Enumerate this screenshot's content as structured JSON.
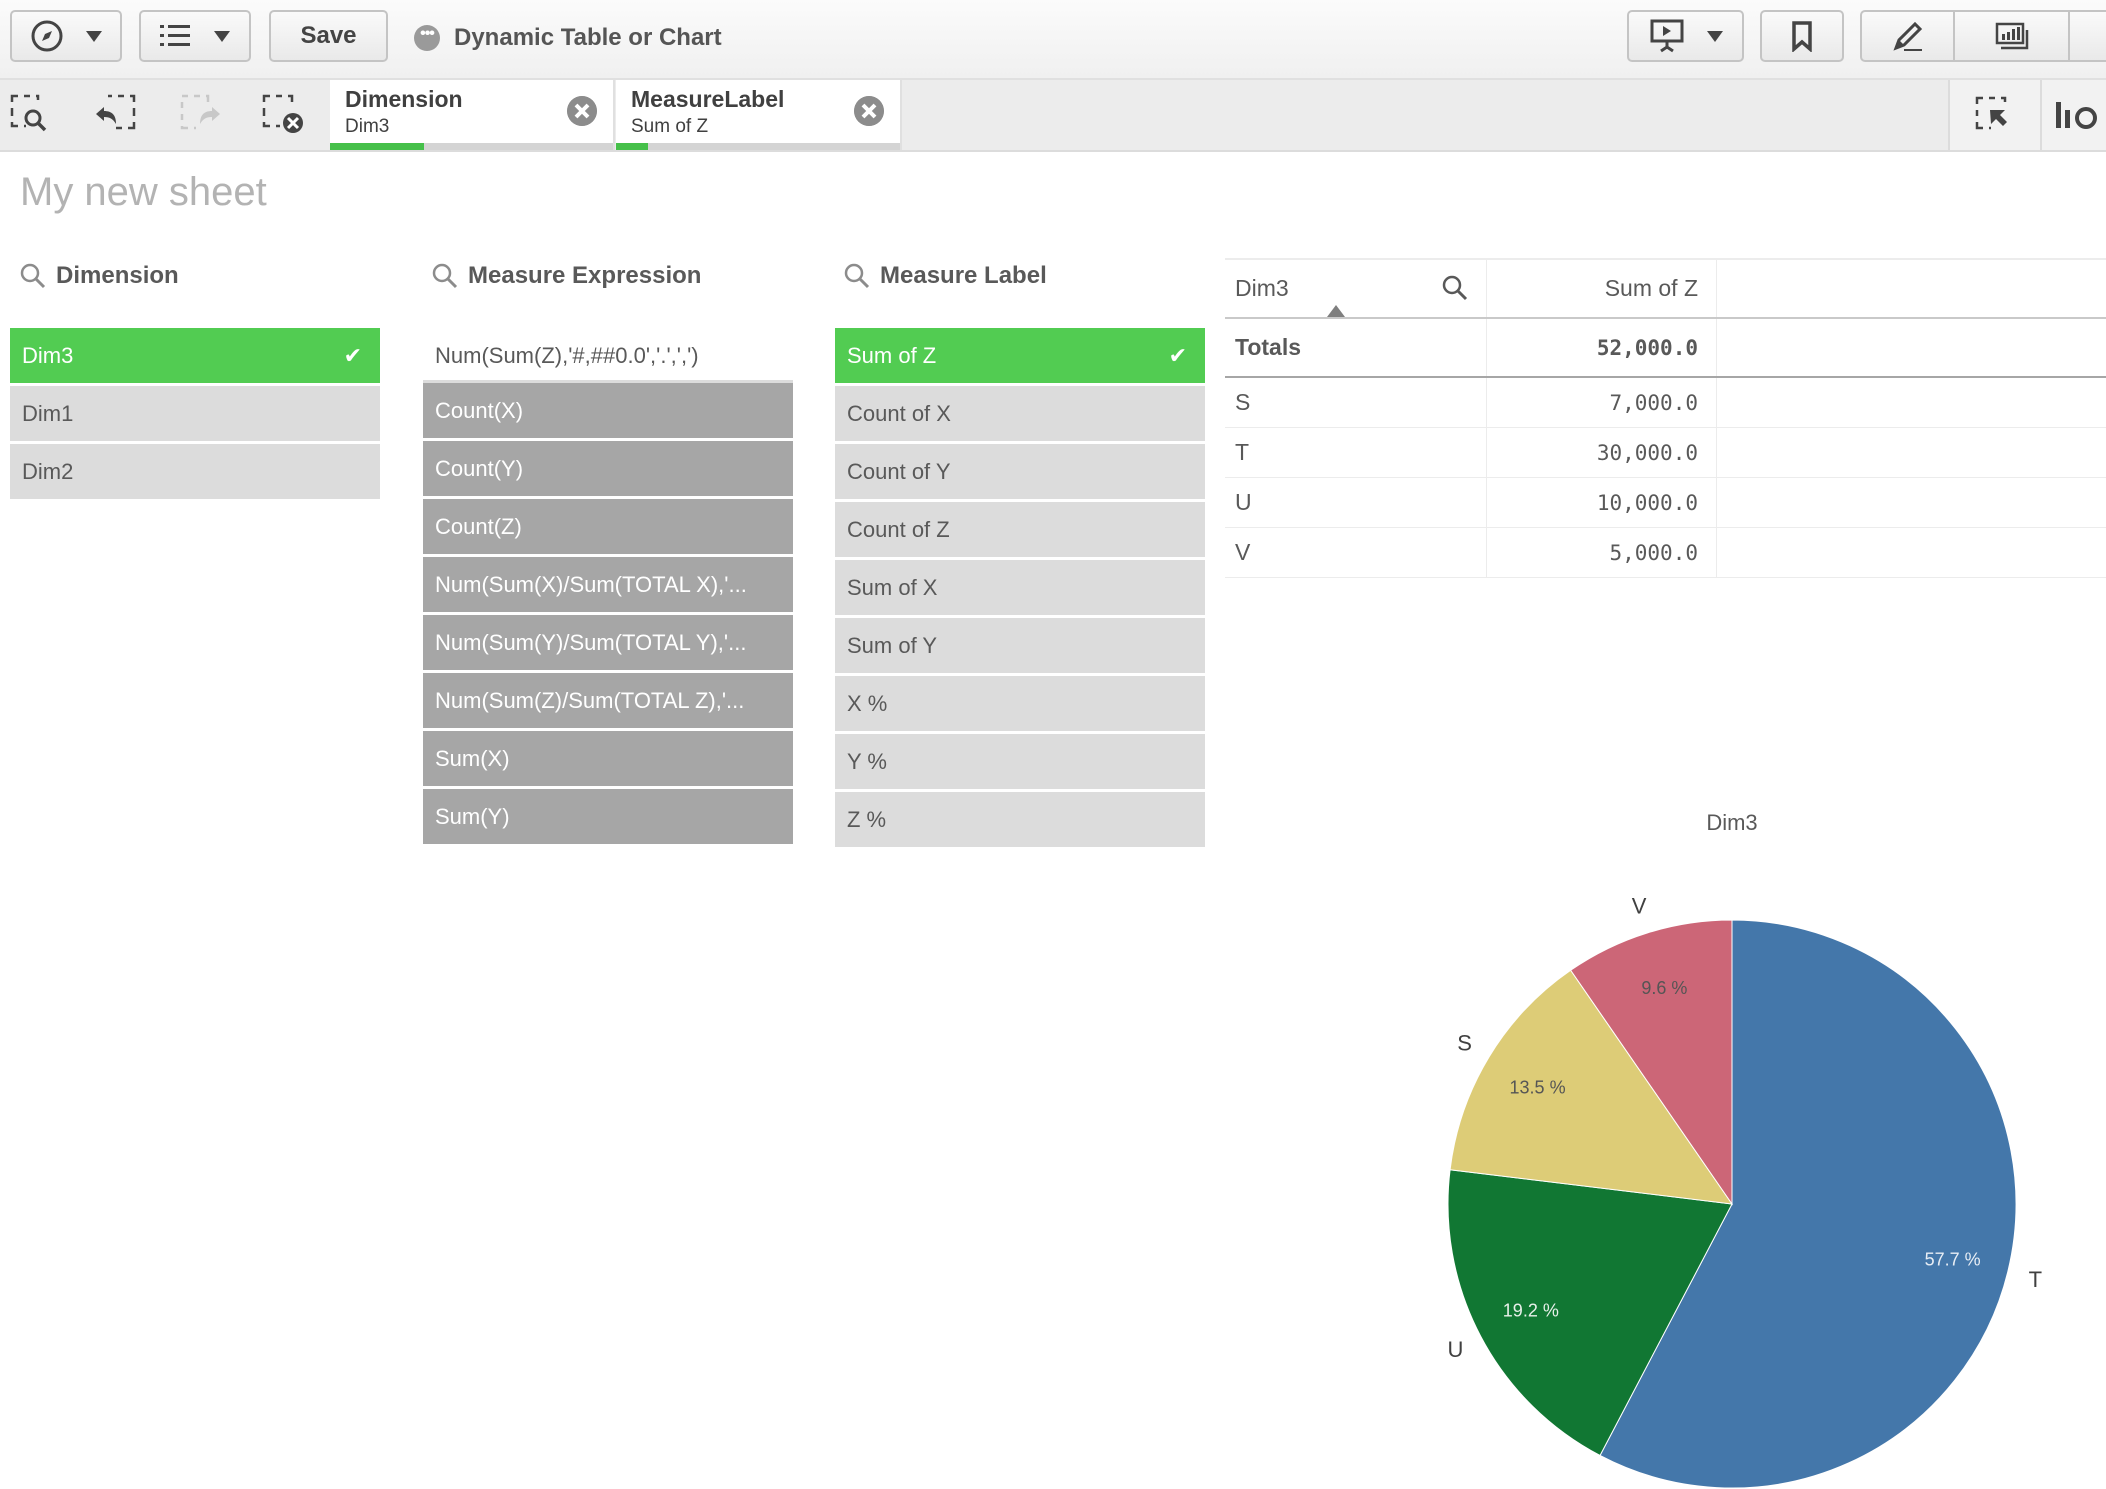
{
  "toolbar": {
    "save_label": "Save",
    "app_title": "Dynamic Table or Chart",
    "icons": [
      "compass-icon",
      "list-icon",
      "presentation-icon",
      "bookmark-icon",
      "edit-pencil-icon",
      "chart-icon"
    ]
  },
  "selections": {
    "chips": [
      {
        "title": "Dimension",
        "value": "Dim3",
        "progress_fraction": 0.333
      },
      {
        "title": "MeasureLabel",
        "value": "Sum of Z",
        "progress_fraction": 0.111
      }
    ]
  },
  "sheet": {
    "title": "My new sheet"
  },
  "dimension_filter": {
    "title": "Dimension",
    "items": [
      {
        "label": "Dim3",
        "state": "selected"
      },
      {
        "label": "Dim1",
        "state": "optional"
      },
      {
        "label": "Dim2",
        "state": "optional"
      }
    ]
  },
  "measure_expression_filter": {
    "title": "Measure Expression",
    "items": [
      {
        "label": "Num(Sum(Z),'#,##0.0','.',',')",
        "state": "possible"
      },
      {
        "label": "Count(X)",
        "state": "excluded"
      },
      {
        "label": "Count(Y)",
        "state": "excluded"
      },
      {
        "label": "Count(Z)",
        "state": "excluded"
      },
      {
        "label": "Num(Sum(X)/Sum(TOTAL X),'...",
        "state": "excluded"
      },
      {
        "label": "Num(Sum(Y)/Sum(TOTAL Y),'...",
        "state": "excluded"
      },
      {
        "label": "Num(Sum(Z)/Sum(TOTAL Z),'...",
        "state": "excluded"
      },
      {
        "label": "Sum(X)",
        "state": "excluded"
      },
      {
        "label": "Sum(Y)",
        "state": "excluded"
      }
    ]
  },
  "measure_label_filter": {
    "title": "Measure Label",
    "items": [
      {
        "label": "Sum of Z",
        "state": "selected"
      },
      {
        "label": "Count of X",
        "state": "optional"
      },
      {
        "label": "Count of Y",
        "state": "optional"
      },
      {
        "label": "Count of Z",
        "state": "optional"
      },
      {
        "label": "Sum of X",
        "state": "optional"
      },
      {
        "label": "Sum of Y",
        "state": "optional"
      },
      {
        "label": "X %",
        "state": "optional"
      },
      {
        "label": "Y %",
        "state": "optional"
      },
      {
        "label": "Z %",
        "state": "optional"
      }
    ]
  },
  "table": {
    "headers": [
      "Dim3",
      "Sum of Z"
    ],
    "totals_label": "Totals",
    "totals_value": "52,000.0",
    "rows": [
      [
        "S",
        "7,000.0"
      ],
      [
        "T",
        "30,000.0"
      ],
      [
        "U",
        "10,000.0"
      ],
      [
        "V",
        "5,000.0"
      ]
    ]
  },
  "colors": {
    "selected": "#52cc52",
    "excluded": "#a6a6a6",
    "optional": "#dcdcdc"
  },
  "chart_data": {
    "type": "pie",
    "title": "Dim3",
    "categories": [
      "T",
      "U",
      "S",
      "V"
    ],
    "values": [
      30000,
      10000,
      7000,
      5000
    ],
    "labels": [
      "57.7 %",
      "19.2 %",
      "13.5 %",
      "9.6 %"
    ],
    "colors": [
      "#4477aa",
      "#117733",
      "#ddcc77",
      "#cc6677"
    ],
    "label_text_colors": [
      "#e8eef5",
      "#e8f0ea",
      "#555555",
      "#555555"
    ],
    "start": "top",
    "direction": "clockwise"
  }
}
